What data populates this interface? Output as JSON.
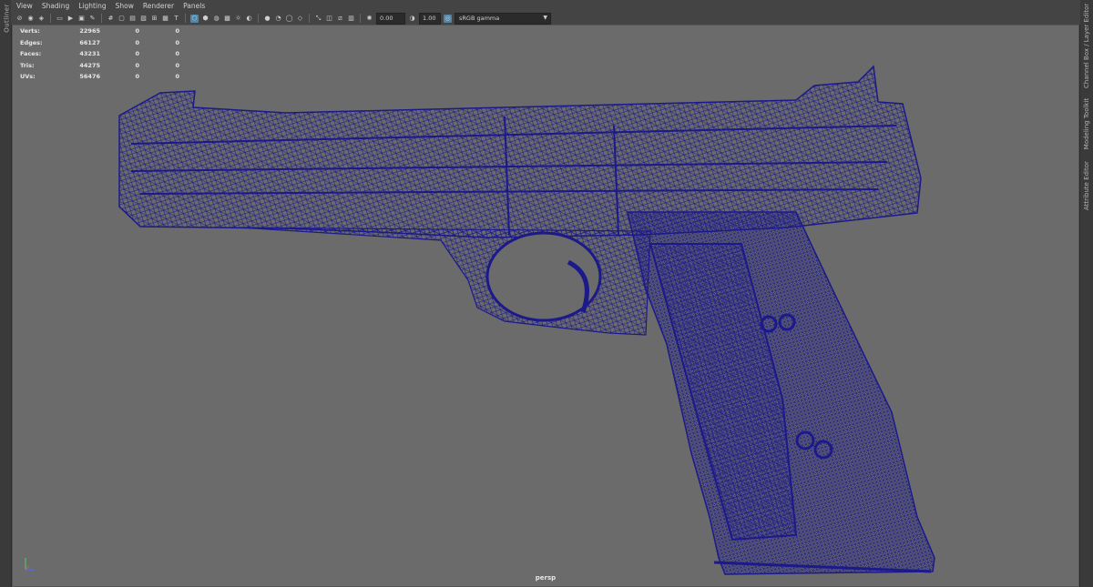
{
  "menu": [
    "View",
    "Shading",
    "Lighting",
    "Show",
    "Renderer",
    "Panels"
  ],
  "left_panel": {
    "label": "Outliner"
  },
  "right_panel": {
    "labels": [
      "Channel Box / Layer Editor",
      "Modeling Toolkit",
      "Attribute Editor"
    ]
  },
  "toolbar": {
    "exposure": "0.00",
    "gamma": "1.00",
    "color_space": "sRGB gamma"
  },
  "hud": {
    "rows": [
      {
        "label": "Verts:",
        "values": [
          "22965",
          "0",
          "0"
        ]
      },
      {
        "label": "Edges:",
        "values": [
          "66127",
          "0",
          "0"
        ]
      },
      {
        "label": "Faces:",
        "values": [
          "43231",
          "0",
          "0"
        ]
      },
      {
        "label": "Tris:",
        "values": [
          "44275",
          "0",
          "0"
        ]
      },
      {
        "label": "UVs:",
        "values": [
          "56476",
          "0",
          "0"
        ]
      }
    ]
  },
  "viewport": {
    "camera": "persp"
  },
  "colors": {
    "wireframe": "#1c1a8a",
    "viewport_bg": "#6b6b6b",
    "accent": "#5285a6"
  }
}
